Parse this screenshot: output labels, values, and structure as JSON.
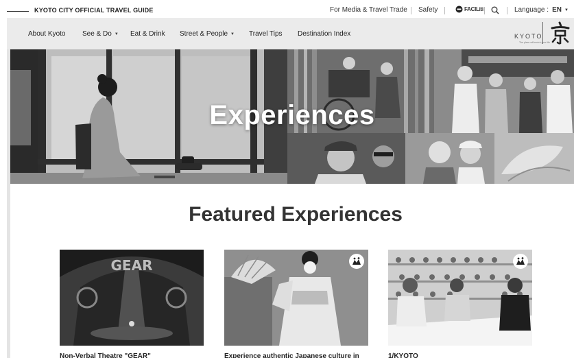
{
  "header": {
    "guide_title": "KYOTO CITY OFFICIAL TRAVEL GUIDE",
    "utility_links": [
      "For Media & Travel Trade",
      "Safety"
    ],
    "facilities_label": "FACILiti",
    "language_label": "Language :",
    "language_value": "EN"
  },
  "nav": {
    "items": [
      {
        "label": "About Kyoto"
      },
      {
        "label": "See & Do"
      },
      {
        "label": "Eat & Drink"
      },
      {
        "label": "Street & People"
      },
      {
        "label": "Travel Tips"
      },
      {
        "label": "Destination Index"
      }
    ],
    "logo_text": "KYOTO",
    "logo_tagline": "The place will enrich your life"
  },
  "hero": {
    "title": "Experiences"
  },
  "featured": {
    "title": "Featured Experiences",
    "cards": [
      {
        "caption": "Non-Verbal Theatre \"GEAR\"",
        "image_text": "GEAR"
      },
      {
        "caption": "Experience authentic Japanese culture in"
      },
      {
        "caption": "1/KYOTO"
      }
    ]
  },
  "icons": {
    "search": "search-icon",
    "language_caret": "caret-down-icon",
    "facilities": "facilities-icon",
    "badge": "award-badge-icon"
  }
}
